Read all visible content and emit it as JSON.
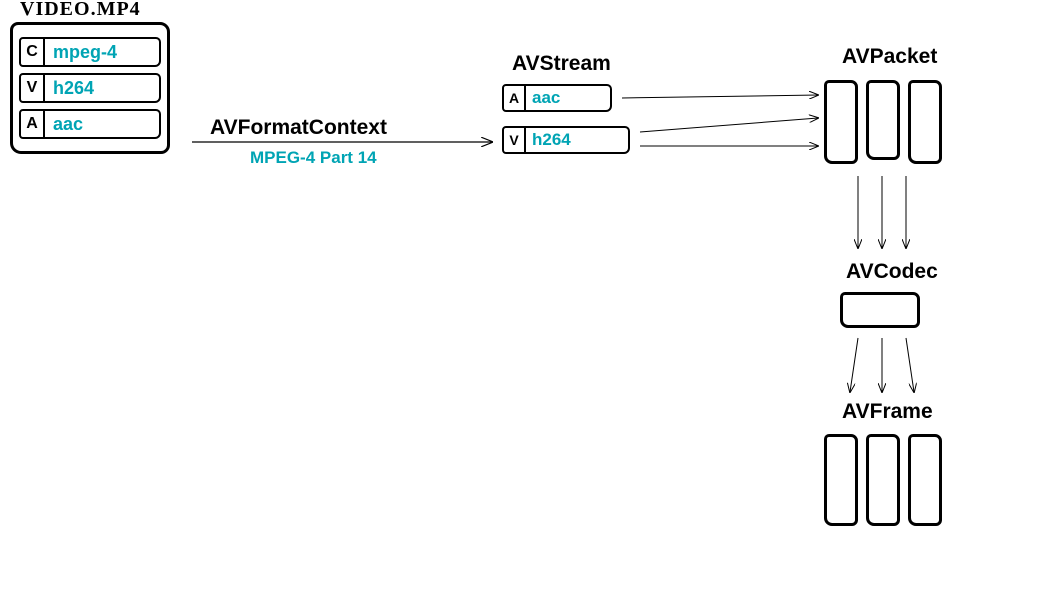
{
  "video_file": {
    "filename": "video.mp4",
    "entries": [
      {
        "badge": "C",
        "label": "mpeg-4"
      },
      {
        "badge": "V",
        "label": "h264"
      },
      {
        "badge": "A",
        "label": "aac"
      }
    ]
  },
  "avformat": {
    "title": "AVFormatContext",
    "subtitle": "MPEG-4 Part 14"
  },
  "avstream": {
    "title": "AVStream",
    "streams": [
      {
        "badge": "A",
        "label": "aac"
      },
      {
        "badge": "V",
        "label": "h264"
      }
    ]
  },
  "avpacket": {
    "title": "AVPacket",
    "count": 3
  },
  "avcodec": {
    "title": "AVCodec"
  },
  "avframe": {
    "title": "AVFrame",
    "count": 3
  }
}
